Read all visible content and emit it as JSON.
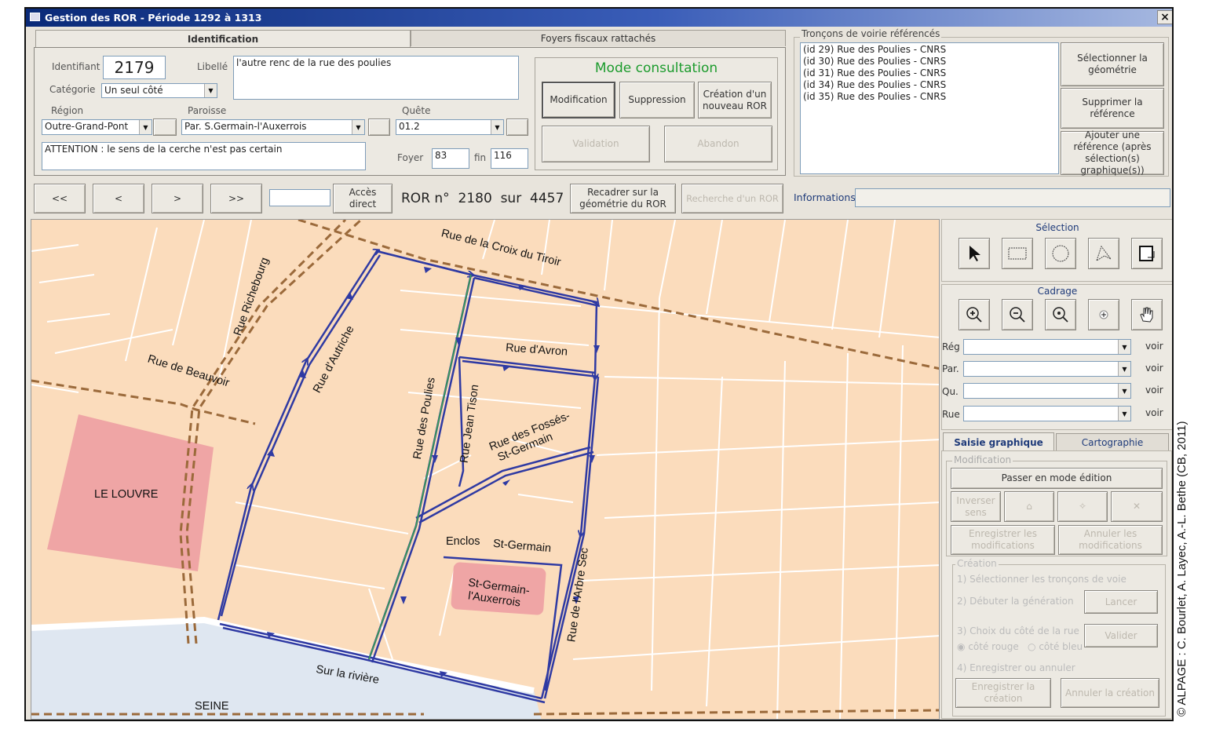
{
  "window": {
    "title": "Gestion des ROR - Période 1292 à 1313",
    "close": "×"
  },
  "tabs": {
    "identification": "Identification",
    "foyers": "Foyers fiscaux rattachés"
  },
  "ident": {
    "id_label": "Identifiant",
    "id_value": "2179",
    "libelle_label": "Libellé",
    "libelle_value": "l'autre renc de la rue des poulies",
    "categorie_label": "Catégorie",
    "categorie_value": "Un seul côté",
    "region_label": "Région",
    "region_value": "Outre-Grand-Pont",
    "paroisse_label": "Paroisse",
    "paroisse_value": "Par. S.Germain-l'Auxerrois",
    "quete_label": "Quête",
    "quete_value": "01.2",
    "note": "ATTENTION : le sens de la cerche n'est pas certain",
    "foyer_label": "Foyer",
    "foyer_value": "83",
    "fin_label": "fin",
    "fin_value": "116"
  },
  "mode": {
    "title": "Mode consultation",
    "modification": "Modification",
    "suppression": "Suppression",
    "creation": "Création d'un nouveau ROR",
    "validation": "Validation",
    "abandon": "Abandon"
  },
  "troncons": {
    "legend": "Tronçons de voirie référencés",
    "items": [
      "(id 29) Rue des Poulies - CNRS",
      "(id 30) Rue des Poulies - CNRS",
      "(id 31) Rue des Poulies - CNRS",
      "(id 34) Rue des Poulies - CNRS",
      "(id 35) Rue des Poulies - CNRS"
    ],
    "select_geom": "Sélectionner la géométrie",
    "suppr_ref": "Supprimer la référence",
    "add_ref": "Ajouter une référence (après sélection(s) graphique(s))"
  },
  "nav": {
    "first": "<<",
    "prev": "<",
    "next": ">",
    "last": ">>",
    "acces": "Accès direct",
    "ror_label": "ROR n°",
    "ror_num": "2180",
    "sur": "sur",
    "total": "4457",
    "recadrer": "Recadrer sur la géométrie du ROR",
    "recherche": "Recherche d'un ROR",
    "informations": "Informations"
  },
  "panel": {
    "selection": "Sélection",
    "cadrage": "Cadrage",
    "reg": "Rég",
    "par": "Par.",
    "qu": "Qu.",
    "rue": "Rue",
    "voir": "voir",
    "tab_saisie": "Saisie graphique",
    "tab_carto": "Cartographie",
    "modification_legend": "Modification",
    "passer": "Passer en mode édition",
    "inverser": "Inverser sens",
    "enregistrer_mod": "Enregistrer les modifications",
    "annuler_mod": "Annuler les modifications",
    "creation_legend": "Création",
    "step1": "1) Sélectionner les tronçons de voie",
    "step2": "2) Débuter la génération",
    "lancer": "Lancer",
    "step3": "3) Choix du côté de la rue",
    "valider": "Valider",
    "cote_rouge": "côté rouge",
    "cote_bleu": "côté bleu",
    "step4": "4) Enregistrer ou annuler",
    "enregistrer_creation": "Enregistrer la création",
    "annuler_creation": "Annuler la création"
  },
  "map": {
    "labels": {
      "croix": "Rue de la Croix du Tiroir",
      "richebourg": "Rue Richebourg",
      "autriche": "Rue d'Autriche",
      "beauvoir": "Rue de Beauvoir",
      "avron": "Rue d'Avron",
      "poulies": "Rue des Poulies",
      "tison": "Rue Jean Tison",
      "fosses": "Rue des Fossés-",
      "fosses2": "St-Germain",
      "louvre": "LE LOUVRE",
      "enclos": "Enclos",
      "stgermain": "St-Germain",
      "arbre": "Rue de l'Arbre Sec",
      "eglise1": "St-Germain-",
      "eglise2": "l'Auxerrois",
      "riviere": "Sur la rivière",
      "seine": "SEINE"
    }
  },
  "copyright": "© ALPAGE : C. Bourlet, A. Layec, A.-L. Bethe (CB, 2011)"
}
